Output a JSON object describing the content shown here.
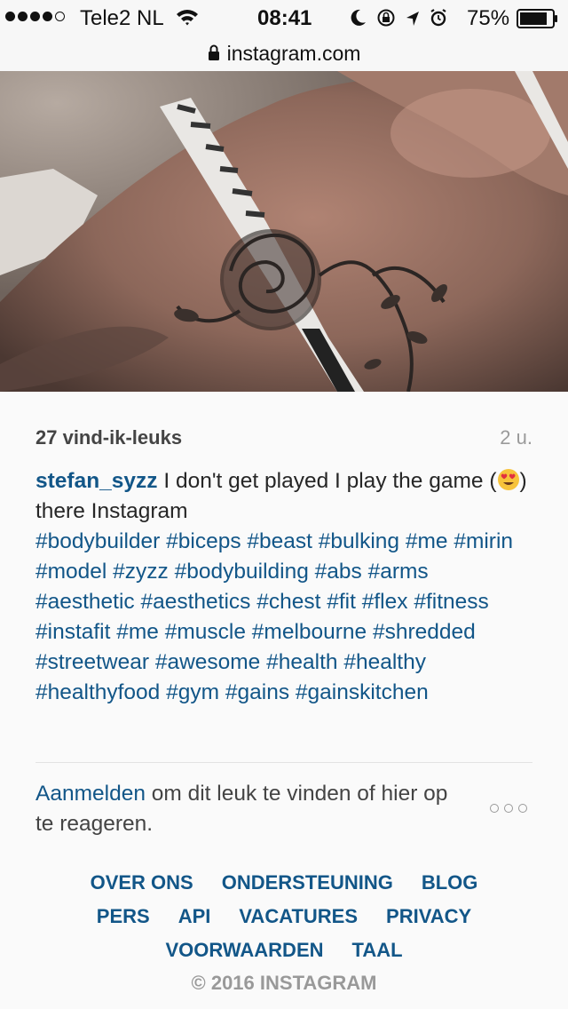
{
  "status_bar": {
    "carrier": "Tele2 NL",
    "time": "08:41",
    "battery": "75%",
    "signal_bars_filled": 4,
    "signal_bars_total": 5,
    "battery_level": 0.75
  },
  "browser": {
    "url": "instagram.com"
  },
  "post": {
    "likes": "27 vind-ik-leuks",
    "time_ago": "2 u.",
    "username": "stefan_syzz",
    "caption_before_emoji": " I don't get played I play the game (",
    "caption_after_emoji": ") there Instagram",
    "hashtags": [
      "#bodybuilder",
      "#biceps",
      "#beast",
      "#bulking",
      "#me",
      "#mirin",
      "#model",
      "#zyzz",
      "#bodybuilding",
      "#abs",
      "#arms",
      "#aesthetic",
      "#aesthetics",
      "#chest",
      "#fit",
      "#flex",
      "#fitness",
      "#instafit",
      "#me",
      "#muscle",
      "#melbourne",
      "#shredded",
      "#streetwear",
      "#awesome",
      "#health",
      "#healthy",
      "#healthyfood",
      "#gym",
      "#gains",
      "#gainskitchen"
    ],
    "login_link": "Aanmelden",
    "login_text": " om dit leuk te vinden of hier op te reageren."
  },
  "footer": {
    "rows": [
      [
        "OVER ONS",
        "ONDERSTEUNING",
        "BLOG"
      ],
      [
        "PERS",
        "API",
        "VACATURES",
        "PRIVACY"
      ],
      [
        "VOORWAARDEN",
        "TAAL"
      ]
    ],
    "copyright": "© 2016 INSTAGRAM"
  },
  "colors": {
    "link": "#125688",
    "text": "#262626",
    "muted": "#9a9a9a",
    "background": "#fafafa"
  }
}
